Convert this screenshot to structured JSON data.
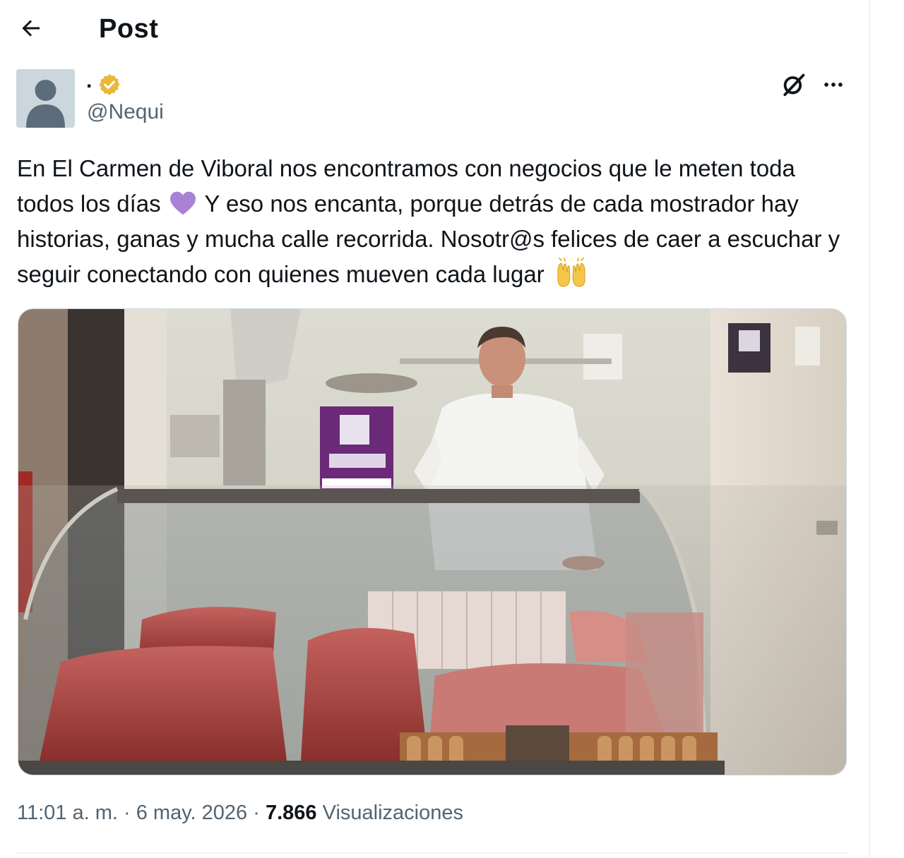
{
  "header": {
    "title": "Post",
    "back_icon": "arrow-left-icon"
  },
  "author": {
    "display_name": ".",
    "handle": "@Nequi",
    "verified": true,
    "verified_color": "#e8b836",
    "avatar_icon": "default-avatar-icon"
  },
  "actions": {
    "hide_icon": "grok-icon",
    "more_icon": "more-icon"
  },
  "post": {
    "text_1": "En El Carmen de Viboral nos encontramos con negocios que le meten toda todos los días",
    "text_2": "Y eso nos encanta, porque detrás de cada mostrador hay historias, ganas y mucha calle recorrida. Nosotr@s felices de caer a escuchar y seguir conectando con quienes mueven cada lugar",
    "emoji_1": "purple-heart-icon",
    "emoji_2": "raising-hands-icon",
    "heart_color": "#a982d6",
    "image_icon": "butcher-shop-photo"
  },
  "meta": {
    "time": "11:01 a. m.",
    "separator": "·",
    "date": "6 may. 2026",
    "views_count": "7.866",
    "views_label": "Visualizaciones"
  }
}
